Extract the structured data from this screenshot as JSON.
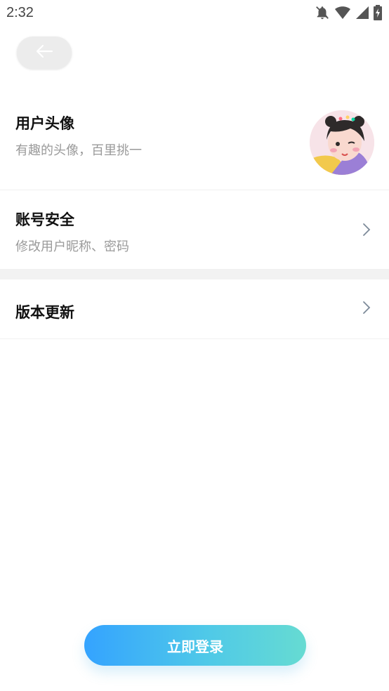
{
  "status_bar": {
    "time": "2:32",
    "icons": [
      "notifications-off-icon",
      "wifi-icon",
      "signal-icon",
      "battery-charging-icon"
    ]
  },
  "header": {
    "back_icon": "arrow-left-icon"
  },
  "settings": {
    "avatar_row": {
      "title": "用户头像",
      "subtitle": "有趣的头像，百里挑一"
    },
    "account_row": {
      "title": "账号安全",
      "subtitle": "修改用户昵称、密码"
    },
    "update_row": {
      "title": "版本更新"
    }
  },
  "login_button": {
    "label": "立即登录"
  },
  "colors": {
    "accent_start": "#34a3ff",
    "accent_end": "#66dbd2",
    "divider_band": "#f2f2f2"
  }
}
